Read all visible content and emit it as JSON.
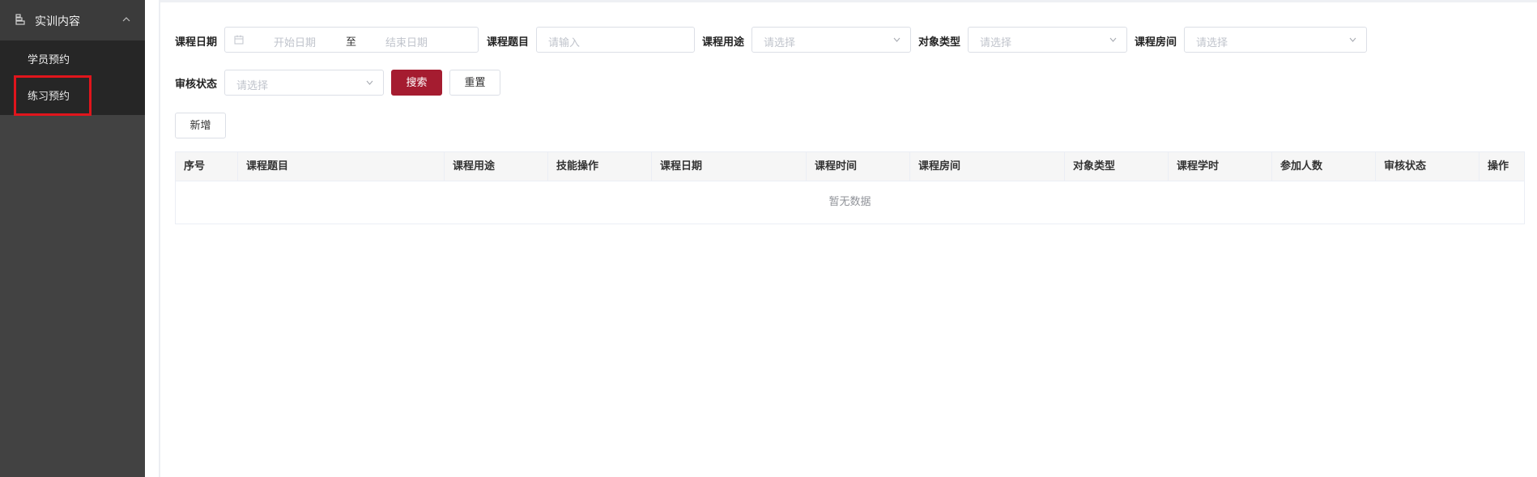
{
  "sidebar": {
    "group_title": "实训内容",
    "items": [
      {
        "label": "学员预约"
      },
      {
        "label": "练习预约"
      }
    ]
  },
  "filters": {
    "course_date_label": "课程日期",
    "start_placeholder": "开始日期",
    "range_separator": "至",
    "end_placeholder": "结束日期",
    "course_topic_label": "课程题目",
    "course_topic_placeholder": "请输入",
    "course_use_label": "课程用途",
    "course_use_placeholder": "请选择",
    "target_type_label": "对象类型",
    "target_type_placeholder": "请选择",
    "course_room_label": "课程房间",
    "course_room_placeholder": "请选择",
    "review_status_label": "审核状态",
    "review_status_placeholder": "请选择"
  },
  "buttons": {
    "search": "搜索",
    "reset": "重置",
    "add": "新增"
  },
  "table": {
    "columns": [
      "序号",
      "课程题目",
      "课程用途",
      "技能操作",
      "课程日期",
      "课程时间",
      "课程房间",
      "对象类型",
      "课程学时",
      "参加人数",
      "审核状态",
      "操作"
    ],
    "empty_text": "暂无数据"
  },
  "colors": {
    "sidebar_bg": "#424242",
    "submenu_bg": "#262626",
    "primary": "#a51c30",
    "highlight_border": "#e0151c"
  }
}
